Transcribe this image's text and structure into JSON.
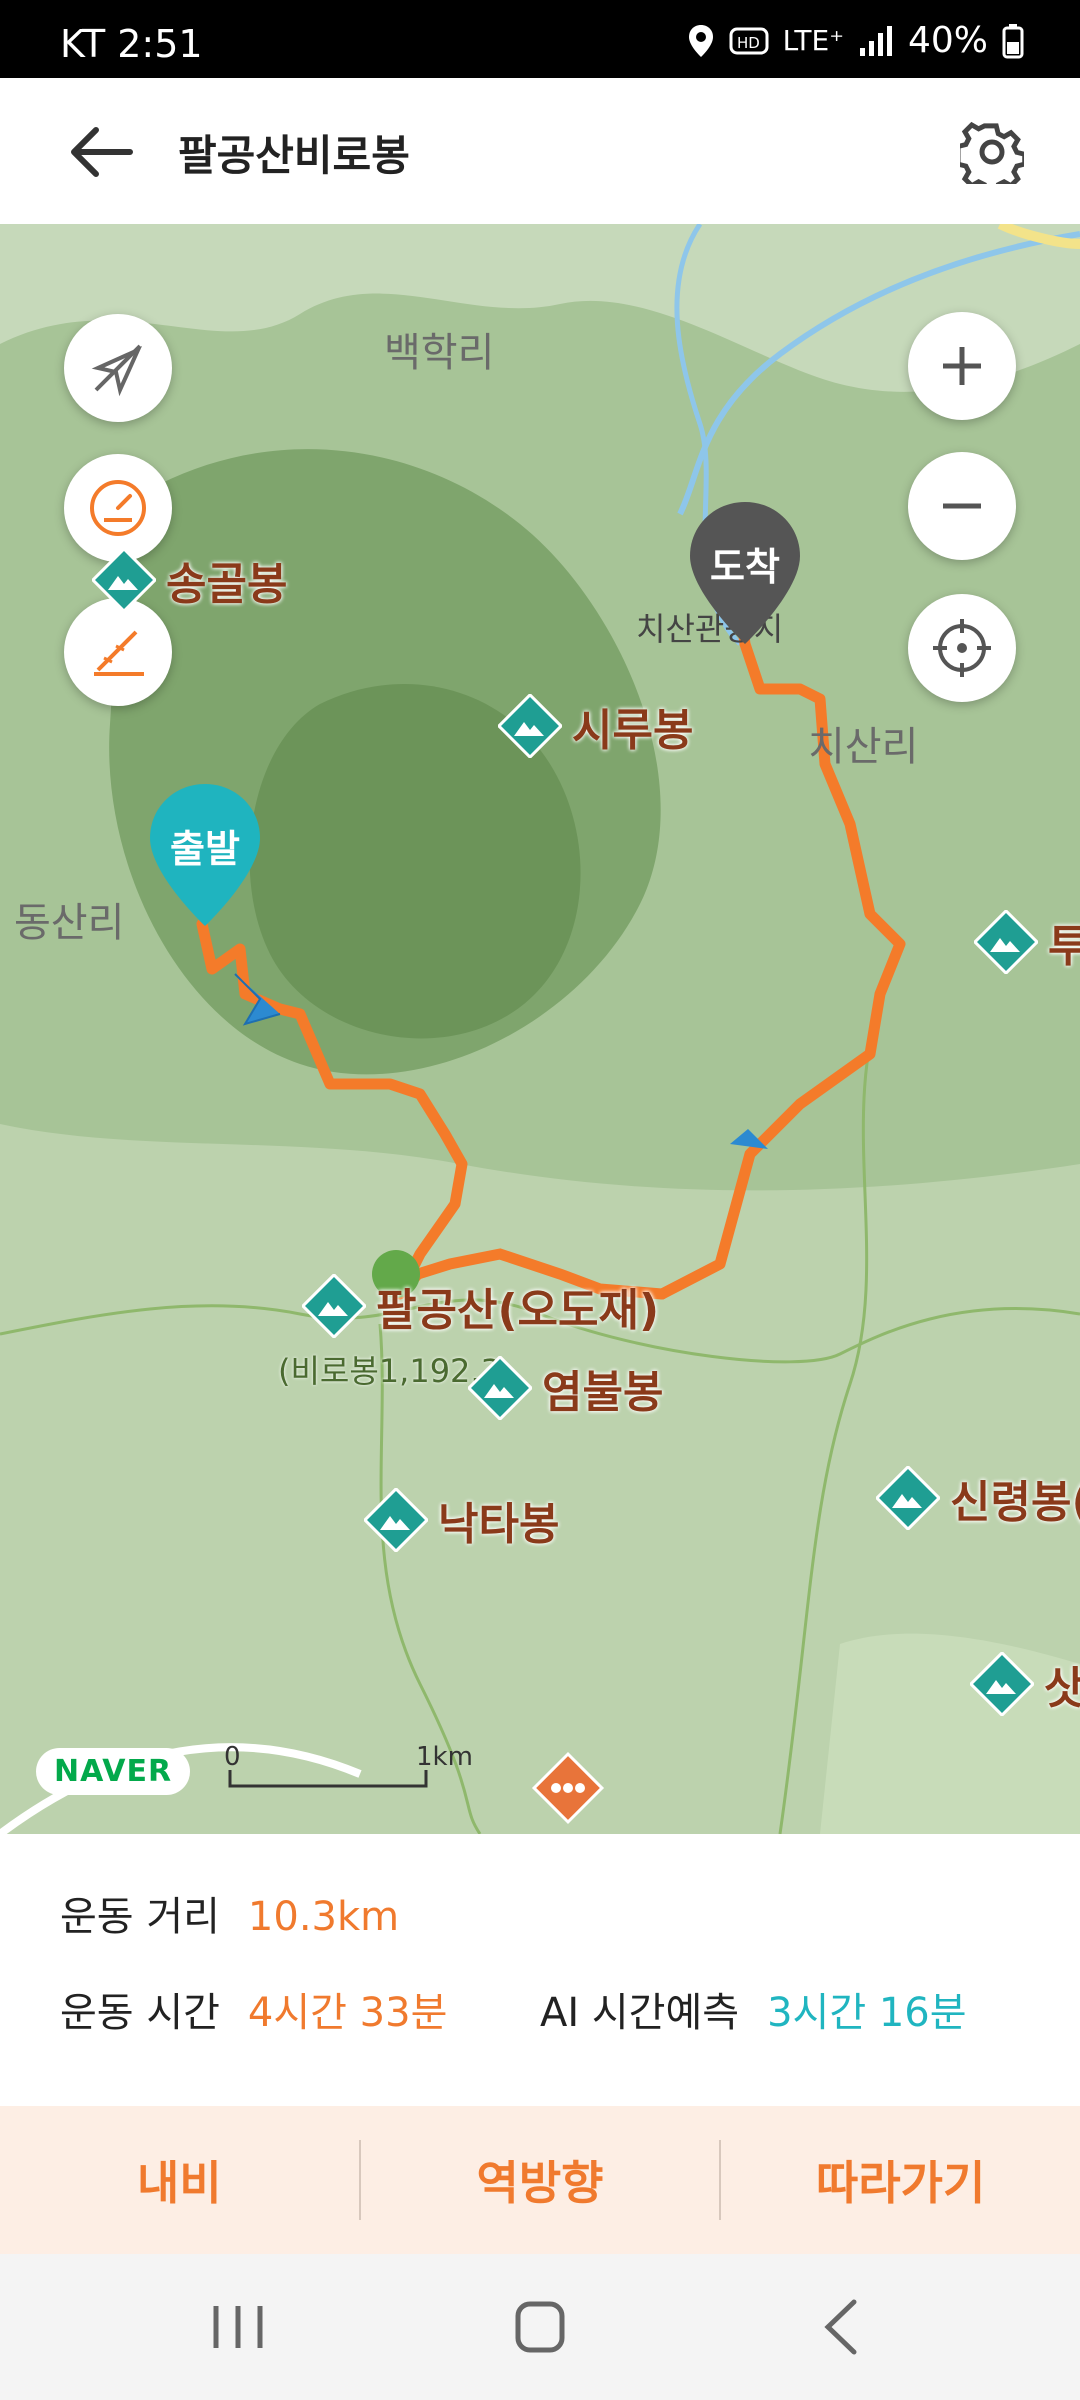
{
  "status_bar": {
    "carrier_time": "KT 2:51",
    "network": "LTE⁺",
    "battery": "40%"
  },
  "header": {
    "title": "팔공산비로봉",
    "back_icon": "arrow-left-icon",
    "settings_icon": "gear-icon"
  },
  "map": {
    "places": [
      "백학리",
      "동산리",
      "치산리",
      "치산관광지"
    ],
    "peaks": [
      "송골봉",
      "시루봉",
      "팔공산(오도재)",
      "염불봉",
      "낙타봉",
      "신령봉(",
      "투",
      "삿"
    ],
    "peak_sublabel": "(비로봉1,192.3",
    "start_label": "출발",
    "end_label": "도착",
    "brand": "NAVER",
    "scale_start": "0",
    "scale_end": "1km",
    "route_color": "#f47b2a"
  },
  "stats": {
    "distance_label": "운동 거리",
    "distance_value": "10.3km",
    "time_label": "운동 시간",
    "time_value": "4시간 33분",
    "ai_label": "AI 시간예측",
    "ai_value": "3시간 16분"
  },
  "actions": {
    "navi": "내비",
    "reverse": "역방향",
    "follow": "따라가기"
  }
}
